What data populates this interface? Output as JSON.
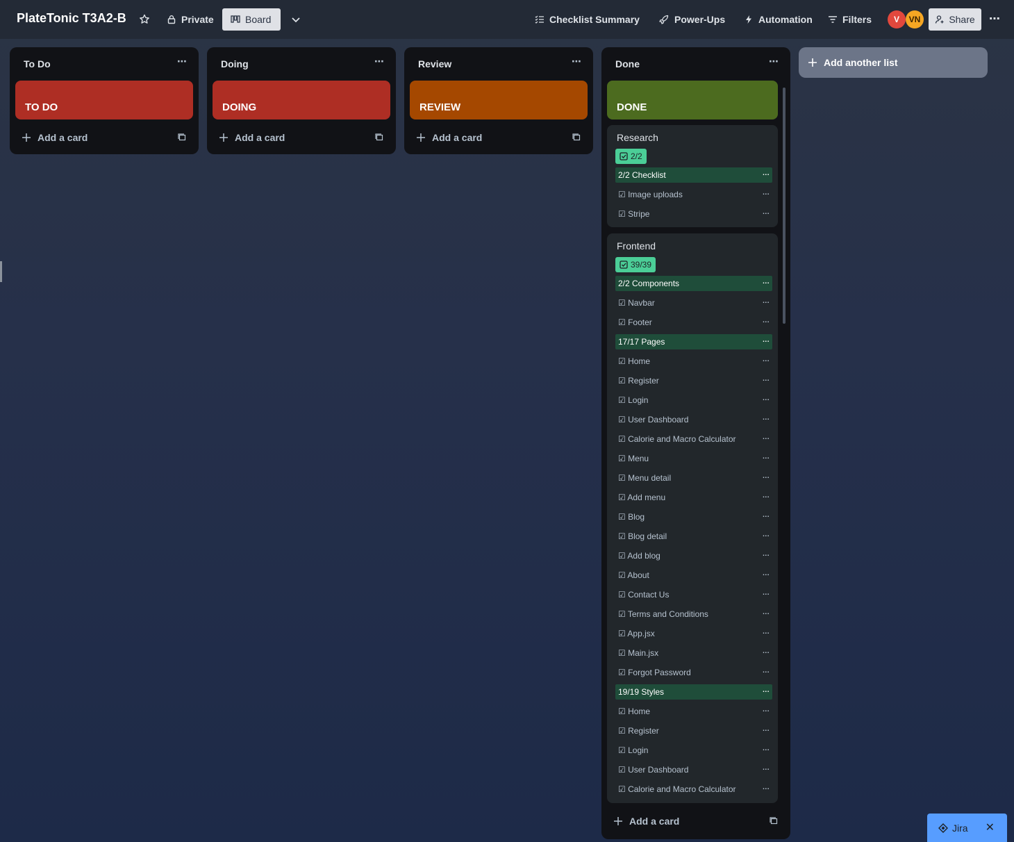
{
  "header": {
    "board_title": "PlateTonic T3A2-B",
    "visibility": "Private",
    "view": "Board",
    "checklist_summary": "Checklist Summary",
    "power_ups": "Power-Ups",
    "automation": "Automation",
    "filters": "Filters",
    "avatars": [
      {
        "initials": "V",
        "color": "#e2483d"
      },
      {
        "initials": "VN",
        "color": "#f5a623"
      }
    ],
    "share": "Share"
  },
  "lists": [
    {
      "title": "To Do",
      "cover_label": "TO DO",
      "cover_color": "#ae2e24",
      "add_card": "Add a card"
    },
    {
      "title": "Doing",
      "cover_label": "DOING",
      "cover_color": "#ae2e24",
      "add_card": "Add a card"
    },
    {
      "title": "Review",
      "cover_label": "REVIEW",
      "cover_color": "#a54800",
      "add_card": "Add a card"
    },
    {
      "title": "Done",
      "cover_label": "DONE",
      "cover_color": "#4c6b1f",
      "add_card": "Add a card"
    }
  ],
  "done_cards": [
    {
      "title": "Research",
      "badge": "2/2",
      "rows": [
        {
          "type": "header",
          "text": "2/2 Checklist"
        },
        {
          "type": "item",
          "text": "☑ Image uploads"
        },
        {
          "type": "item",
          "text": "☑ Stripe"
        }
      ]
    },
    {
      "title": "Frontend",
      "badge": "39/39",
      "rows": [
        {
          "type": "header",
          "text": "2/2 Components"
        },
        {
          "type": "item",
          "text": "☑ Navbar"
        },
        {
          "type": "item",
          "text": "☑ Footer"
        },
        {
          "type": "header",
          "text": "17/17 Pages"
        },
        {
          "type": "item",
          "text": "☑ Home"
        },
        {
          "type": "item",
          "text": "☑ Register"
        },
        {
          "type": "item",
          "text": "☑ Login"
        },
        {
          "type": "item",
          "text": "☑ User Dashboard"
        },
        {
          "type": "item",
          "text": "☑ Calorie and Macro Calculator"
        },
        {
          "type": "item",
          "text": "☑ Menu"
        },
        {
          "type": "item",
          "text": "☑ Menu detail"
        },
        {
          "type": "item",
          "text": "☑ Add menu"
        },
        {
          "type": "item",
          "text": "☑ Blog"
        },
        {
          "type": "item",
          "text": "☑ Blog detail"
        },
        {
          "type": "item",
          "text": "☑ Add blog"
        },
        {
          "type": "item",
          "text": "☑ About"
        },
        {
          "type": "item",
          "text": "☑ Contact Us"
        },
        {
          "type": "item",
          "text": "☑ Terms and Conditions"
        },
        {
          "type": "item",
          "text": "☑ App.jsx"
        },
        {
          "type": "item",
          "text": "☑ Main.jsx"
        },
        {
          "type": "item",
          "text": "☑ Forgot Password"
        },
        {
          "type": "header",
          "text": "19/19 Styles"
        },
        {
          "type": "item",
          "text": "☑ Home"
        },
        {
          "type": "item",
          "text": "☑ Register"
        },
        {
          "type": "item",
          "text": "☑ Login"
        },
        {
          "type": "item",
          "text": "☑ User Dashboard"
        },
        {
          "type": "item",
          "text": "☑ Calorie and Macro Calculator"
        }
      ]
    }
  ],
  "add_list": "Add another list",
  "jira": "Jira"
}
